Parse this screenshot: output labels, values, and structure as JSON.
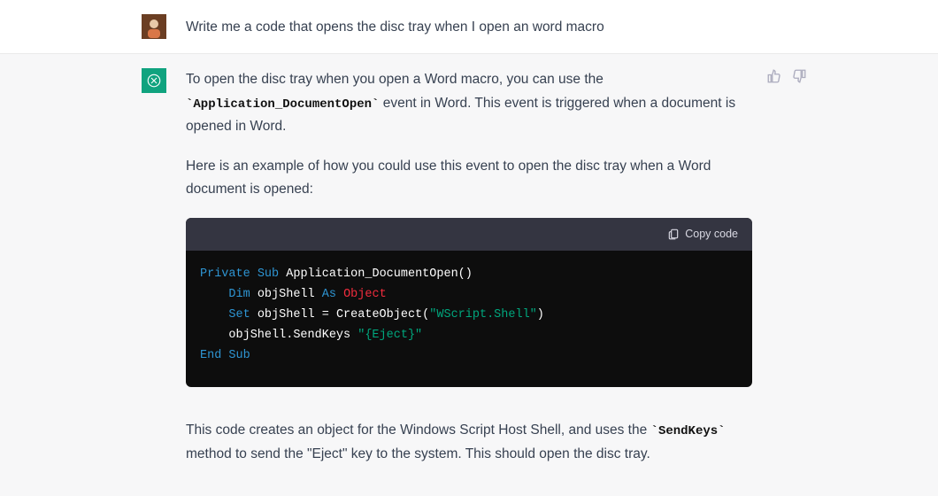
{
  "user": {
    "prompt": "Write me a code that opens the disc tray when I open an word macro"
  },
  "assistant": {
    "p1_a": "To open the disc tray when you open a Word macro, you can use the ",
    "p1_code": "`Application_DocumentOpen`",
    "p1_b": " event in Word. This event is triggered when a document is opened in Word.",
    "p2": "Here is an example of how you could use this event to open the disc tray when a Word document is opened:",
    "copy_label": "Copy code",
    "code": {
      "l1_a": "Private",
      "l1_b": "Sub",
      "l1_c": "Application_DocumentOpen()",
      "l2_a": "Dim",
      "l2_b": "objShell",
      "l2_c": "As",
      "l2_d": "Object",
      "l3_a": "Set",
      "l3_b": "objShell = CreateObject(",
      "l3_c": "\"WScript.Shell\"",
      "l3_d": ")",
      "l4_a": "objShell.SendKeys ",
      "l4_b": "\"{Eject}\"",
      "l5_a": "End",
      "l5_b": "Sub"
    },
    "p3_a": "This code creates an object for the Windows Script Host Shell, and uses the ",
    "p3_code": "`SendKeys`",
    "p3_b": " method to send the \"Eject\" key to the system. This should open the disc tray."
  }
}
